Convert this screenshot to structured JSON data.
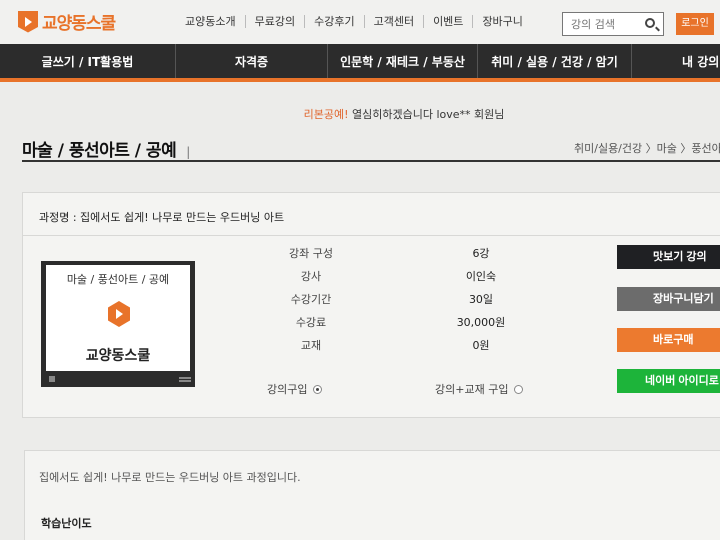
{
  "header": {
    "logo_brand": "교양동스쿨",
    "nav": [
      "교양동소개",
      "무료강의",
      "수강후기",
      "고객센터",
      "이벤트",
      "장바구니"
    ],
    "search_placeholder": "강의 검색",
    "login_label": "로그인"
  },
  "categories": [
    "글쓰기 / IT활용법",
    "자격증",
    "인문학 / 재테크 / 부동산",
    "취미 / 실용 / 건강 / 암기",
    "내 강의"
  ],
  "welcome": {
    "highlight": "리본공예!",
    "message": "열심히하겠습니다 love** 회원님"
  },
  "page": {
    "title": "마술 / 풍선아트 / 공예",
    "title_mark": "|",
    "breadcrumb": "취미/실용/건강 〉마술 〉풍선아트"
  },
  "course": {
    "name": "과정명 : 집에서도 쉽게! 나무로 만드는 우드버닝 아트",
    "thumbnail": {
      "category": "마술 / 풍선아트 / 공예",
      "logo": "교양동스쿨"
    },
    "info": [
      {
        "key": "강좌 구성",
        "value": "6강"
      },
      {
        "key": "강사",
        "value": "이인숙"
      },
      {
        "key": "수강기간",
        "value": "30일"
      },
      {
        "key": "수강료",
        "value": "30,000원"
      },
      {
        "key": "교재",
        "value": "0원"
      }
    ],
    "options": [
      {
        "label": "강의구입",
        "selected": true
      },
      {
        "label": "강의+교재 구입",
        "selected": false
      }
    ],
    "buttons": {
      "preview": "맛보기 강의",
      "cart": "장바구니담기",
      "buy": "바로구매",
      "naver": "네이버 아이디로 구매"
    }
  },
  "description": {
    "text": "집에서도 쉽게! 나무로 만드는 우드버닝 아트 과정입니다.",
    "difficulty_label": "학습난이도"
  },
  "colors": {
    "accent": "#e8732a",
    "dark": "#2c2c2c",
    "naver": "#1db43a"
  }
}
